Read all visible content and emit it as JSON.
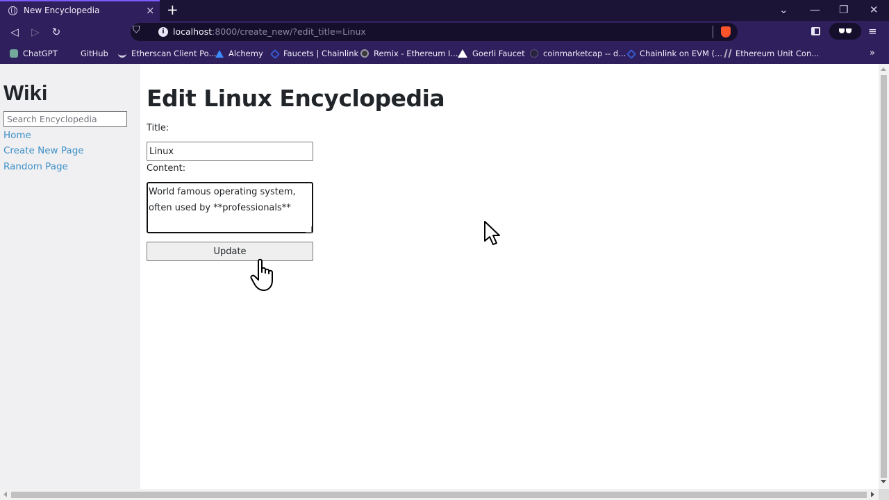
{
  "browser": {
    "tab_title": "New Encyclopedia",
    "tab_close": "×",
    "new_tab": "+",
    "url_host": "localhost",
    "url_rest": ":8000/create_new/?edit_title=Linux",
    "url_info_glyph": "i",
    "window_controls": [
      "⌄",
      "—",
      "❐",
      "✕"
    ],
    "nav": {
      "back": "◁",
      "forward": "▷",
      "reload": "↻",
      "bookmark": "⛉",
      "menu": "≡"
    },
    "bookmarks": [
      {
        "label": "ChatGPT",
        "icon": "chatgpt-icon"
      },
      {
        "label": "GitHub",
        "icon": "github-icon"
      },
      {
        "label": "Etherscan Client Po...",
        "icon": "etherscan-icon"
      },
      {
        "label": "Alchemy",
        "icon": "alchemy-icon"
      },
      {
        "label": "Faucets | Chainlink",
        "icon": "chainlink-icon"
      },
      {
        "label": "Remix - Ethereum I...",
        "icon": "remix-icon"
      },
      {
        "label": "Goerli Faucet",
        "icon": "goerli-icon"
      },
      {
        "label": "coinmarketcap -- d...",
        "icon": "coinmarketcap-icon"
      },
      {
        "label": "Chainlink on EVM (...",
        "icon": "chainlink-icon"
      },
      {
        "label": "Ethereum Unit Con...",
        "icon": "ethereum-unit-icon"
      }
    ],
    "bookmarks_more": "»"
  },
  "sidebar": {
    "site_title": "Wiki",
    "search_placeholder": "Search Encyclopedia",
    "links": [
      "Home",
      "Create New Page",
      "Random Page"
    ]
  },
  "main": {
    "heading": "Edit Linux Encyclopedia",
    "title_label": "Title:",
    "title_value": "Linux",
    "content_label": "Content:",
    "content_value": "World famous operating system, often used by **professionals**",
    "submit_label": "Update"
  },
  "colors": {
    "chrome_bg": "#2f1f5c",
    "tabbar_bg": "#1c1436",
    "link": "#3d8fc6",
    "sidebar_bg": "#f0f0f2"
  }
}
